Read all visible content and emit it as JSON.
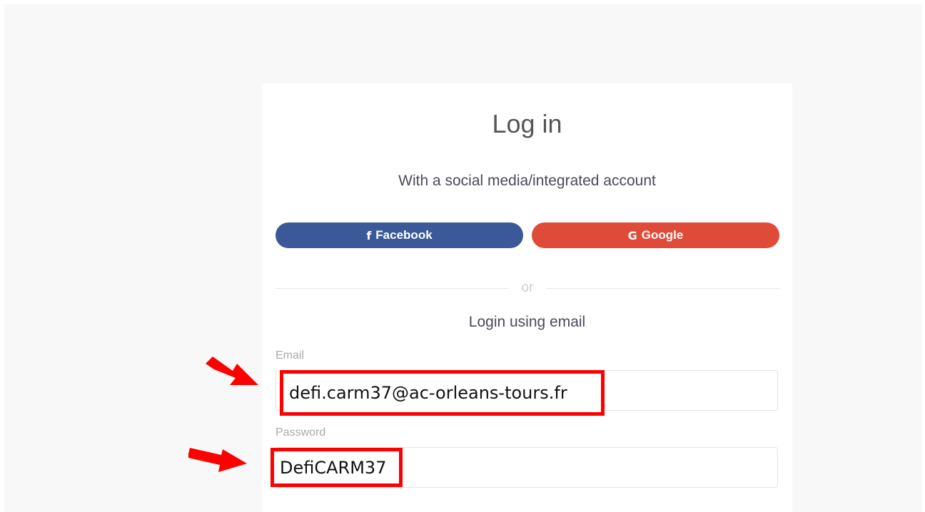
{
  "login": {
    "title": "Log in",
    "social_caption": "With a social media/integrated account",
    "facebook_label": "Facebook",
    "facebook_glyph": "f",
    "google_label": "Google",
    "google_glyph": "G",
    "divider_text": "or",
    "email_caption": "Login using email",
    "email_label": "Email",
    "email_value": "defi.carm37@ac-orleans-tours.fr",
    "password_label": "Password",
    "password_value": "DefiCARM37"
  },
  "colors": {
    "facebook": "#3b5998",
    "google": "#e04a39",
    "highlight": "#ff0000"
  },
  "icons": [
    "facebook-icon",
    "google-icon",
    "arrow-right-icon"
  ]
}
